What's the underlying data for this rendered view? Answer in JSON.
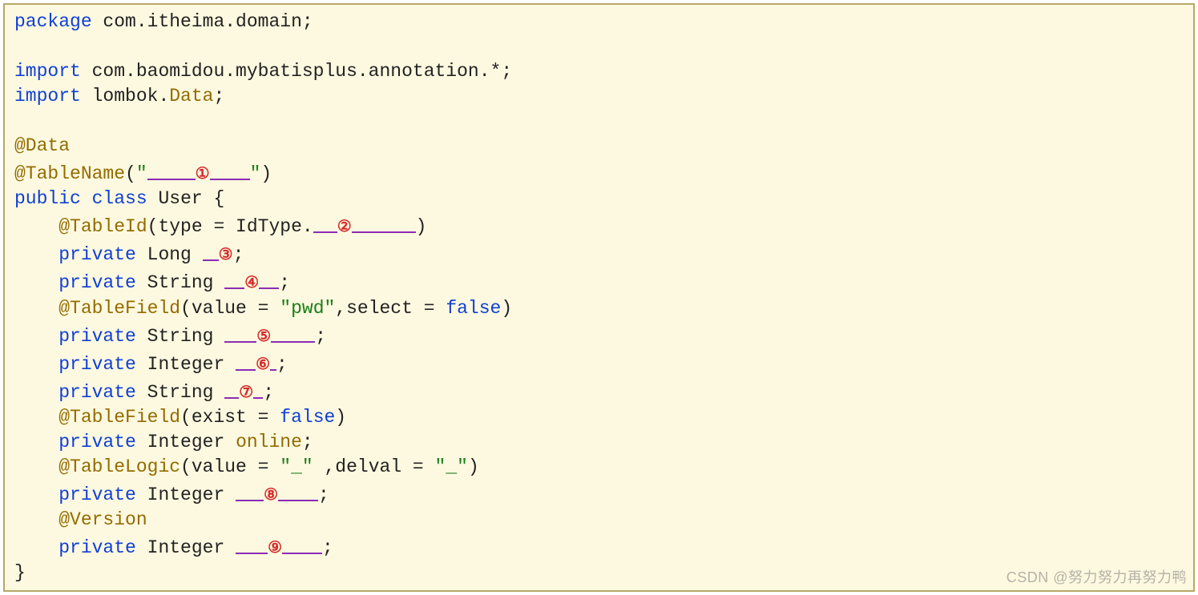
{
  "line1_kw": "package",
  "line1_pkg": " com.itheima.domain;",
  "line3_kw": "import",
  "line3_pkg": " com.baomidou.mybatisplus.annotation.*;",
  "line4_kw": "import",
  "line4_pkg_a": " lombok.",
  "line4_ref": "Data",
  "line4_semi": ";",
  "ann_data": "@Data",
  "ann_tablename_a": "@TableName",
  "ann_tablename_open": "(",
  "str_quote1": "\"",
  "str_quote2": "\"",
  "paren_close": ")",
  "cls_public": "public",
  "cls_class": " class",
  "cls_name": " User {",
  "ann_tableid": "@TableId",
  "tableid_text_a": "(type = IdType.",
  "tableid_text_b": ")",
  "priv": "private",
  "type_long": " Long ",
  "type_string": " String ",
  "type_integer": " Integer ",
  "semi": ";",
  "ann_tablefield": "@TableField",
  "tf_value_a": "(value = ",
  "tf_value_str": "\"pwd\"",
  "tf_value_b": ",select = ",
  "tf_false": "false",
  "tf_value_c": ")",
  "tf_exist_a": "(exist = ",
  "tf_exist_c": ")",
  "online_id": "online",
  "ann_tablelogic": "@TableLogic",
  "tl_a": "(value = ",
  "tl_str1": "\"_\"",
  "tl_b": " ,delval = ",
  "tl_str2": "\"_\"",
  "tl_c": ")",
  "ann_version": "@Version",
  "close_brace": "}",
  "circle1": "①",
  "circle2": "②",
  "circle3": "③",
  "circle4": "④",
  "circle5": "⑤",
  "circle6": "⑥",
  "circle7": "⑦",
  "circle8": "⑧",
  "circle9": "⑨",
  "watermark": "CSDN @努力努力再努力鸭"
}
